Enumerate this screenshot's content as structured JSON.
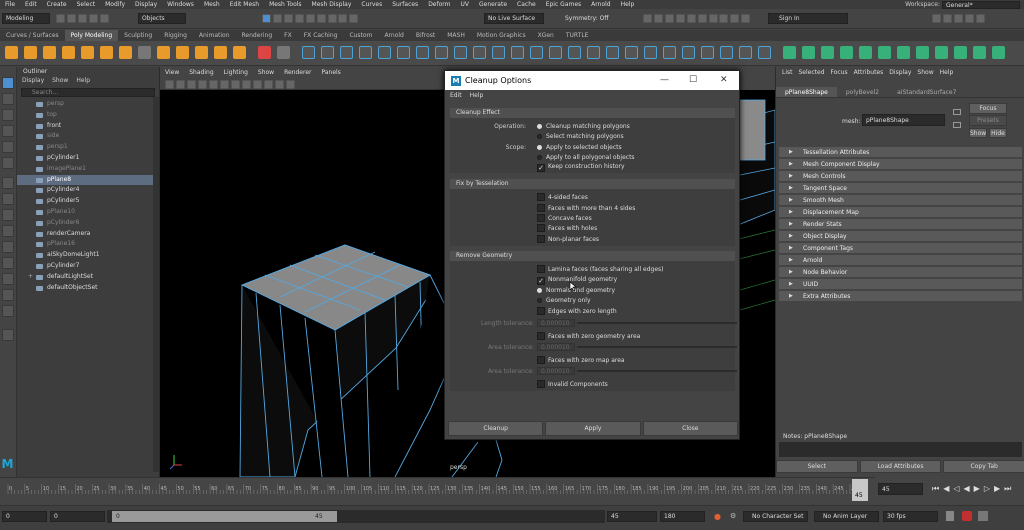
{
  "menubar": {
    "items": [
      "File",
      "Edit",
      "Create",
      "Select",
      "Modify",
      "Display",
      "Windows",
      "Mesh",
      "Edit Mesh",
      "Mesh Tools",
      "Mesh Display",
      "Curves",
      "Surfaces",
      "Deform",
      "UV",
      "Generate",
      "Cache",
      "Epic Games",
      "Arnold",
      "Help"
    ],
    "workspace_label": "Workspace:",
    "workspace_value": "General*"
  },
  "statusline": {
    "mode": "Modeling",
    "objects": "Objects",
    "live_surface": "No Live Surface",
    "symmetry": "Symmetry: Off",
    "sign_in": "Sign In"
  },
  "shelf": {
    "tabs": [
      "Curves / Surfaces",
      "Poly Modeling",
      "Sculpting",
      "Rigging",
      "Animation",
      "Rendering",
      "FX",
      "FX Caching",
      "Custom",
      "Arnold",
      "Bifrost",
      "MASH",
      "Motion Graphics",
      "XGen",
      "TURTLE"
    ],
    "active_tab": "Poly Modeling"
  },
  "outliner": {
    "title": "Outliner",
    "menu": [
      "Display",
      "Show",
      "Help"
    ],
    "search_placeholder": "Search...",
    "items": [
      {
        "label": "persp",
        "dim": true,
        "plus": false,
        "sel": false
      },
      {
        "label": "top",
        "dim": true,
        "plus": false,
        "sel": false
      },
      {
        "label": "front",
        "dim": false,
        "plus": false,
        "sel": false
      },
      {
        "label": "side",
        "dim": true,
        "plus": false,
        "sel": false
      },
      {
        "label": "persp1",
        "dim": true,
        "plus": false,
        "sel": false
      },
      {
        "label": "pCylinder1",
        "dim": false,
        "plus": false,
        "sel": false
      },
      {
        "label": "imagePlane1",
        "dim": true,
        "plus": false,
        "sel": false
      },
      {
        "label": "pPlane8",
        "dim": false,
        "plus": false,
        "sel": true
      },
      {
        "label": "pCylinder4",
        "dim": false,
        "plus": false,
        "sel": false
      },
      {
        "label": "pCylinder5",
        "dim": false,
        "plus": false,
        "sel": false
      },
      {
        "label": "pPlane10",
        "dim": true,
        "plus": false,
        "sel": false
      },
      {
        "label": "pCylinder6",
        "dim": true,
        "plus": false,
        "sel": false
      },
      {
        "label": "renderCamera",
        "dim": false,
        "plus": false,
        "sel": false
      },
      {
        "label": "pPlane16",
        "dim": true,
        "plus": false,
        "sel": false
      },
      {
        "label": "aiSkyDomeLight1",
        "dim": false,
        "plus": false,
        "sel": false
      },
      {
        "label": "pCylinder7",
        "dim": false,
        "plus": false,
        "sel": false
      },
      {
        "label": "defaultLightSet",
        "dim": false,
        "plus": true,
        "sel": false
      },
      {
        "label": "defaultObjectSet",
        "dim": false,
        "plus": false,
        "sel": false
      }
    ]
  },
  "viewport": {
    "menu": [
      "View",
      "Shading",
      "Lighting",
      "Show",
      "Renderer",
      "Panels"
    ],
    "camera_label": "persp"
  },
  "dialog": {
    "title": "Cleanup Options",
    "menu": [
      "Edit",
      "Help"
    ],
    "cleanup_effect": {
      "header": "Cleanup Effect",
      "operation_label": "Operation:",
      "operation_options": [
        "Cleanup matching polygons",
        "Select matching polygons"
      ],
      "scope_label": "Scope:",
      "scope_options": [
        "Apply to selected objects",
        "Apply to all polygonal objects"
      ],
      "keep_history": "Keep construction history"
    },
    "fix_tess": {
      "header": "Fix by Tesselation",
      "options": [
        "4-sided faces",
        "Faces with more than 4 sides",
        "Concave faces",
        "Faces with holes",
        "Non-planar faces"
      ]
    },
    "remove_geo": {
      "header": "Remove Geometry",
      "lamina": "Lamina faces (faces sharing all edges)",
      "nonmanifold": "Nonmanifold geometry",
      "normals_geo": "Normals and geometry",
      "geo_only": "Geometry only",
      "zero_edges": "Edges with zero length",
      "length_tol_label": "Length tolerance:",
      "length_tol_value": "0.000010",
      "zero_faces": "Faces with zero geometry area",
      "area_tol_label": "Area tolerance:",
      "area_tol_value": "0.000010",
      "zero_map": "Faces with zero map area",
      "area_tol2_label": "Area tolerance:",
      "area_tol2_value": "0.000010",
      "invalid": "Invalid Components"
    },
    "buttons": [
      "Cleanup",
      "Apply",
      "Close"
    ]
  },
  "attribute_editor": {
    "menu": [
      "List",
      "Selected",
      "Focus",
      "Attributes",
      "Display",
      "Show",
      "Help"
    ],
    "tabs": [
      "pPlane8Shape",
      "polyBevel2",
      "aiStandardSurface7"
    ],
    "mesh_label": "mesh:",
    "mesh_value": "pPlane8Shape",
    "focus": "Focus",
    "presets": "Presets",
    "show": "Show",
    "hide": "Hide",
    "sections": [
      "Tessellation Attributes",
      "Mesh Component Display",
      "Mesh Controls",
      "Tangent Space",
      "Smooth Mesh",
      "Displacement Map",
      "Render Stats",
      "Object Display",
      "Component Tags",
      "Arnold",
      "Node Behavior",
      "UUID",
      "Extra Attributes"
    ],
    "notes": "Notes: pPlane8Shape",
    "bottom_buttons": [
      "Select",
      "Load Attributes",
      "Copy Tab"
    ]
  },
  "timeline": {
    "ticks": [
      "0",
      "5",
      "10",
      "15",
      "20",
      "25",
      "30",
      "35",
      "40",
      "45",
      "50",
      "55",
      "60",
      "65",
      "70",
      "75",
      "80",
      "85",
      "90",
      "95",
      "100",
      "105",
      "110",
      "115",
      "120",
      "125",
      "130",
      "135",
      "140",
      "145",
      "150",
      "155",
      "160",
      "165",
      "170",
      "175",
      "180",
      "185",
      "190",
      "195",
      "200",
      "205",
      "210",
      "215",
      "220",
      "225",
      "230",
      "235",
      "240",
      "245",
      "250"
    ],
    "current_frame": "45",
    "current_field": "45"
  },
  "range": {
    "start": "0",
    "start2": "0",
    "slider_start": "0",
    "slider_end": "45",
    "end": "45",
    "end2": "180",
    "character_set": "No Character Set",
    "anim_layer": "No Anim Layer",
    "fps": "30 fps"
  }
}
